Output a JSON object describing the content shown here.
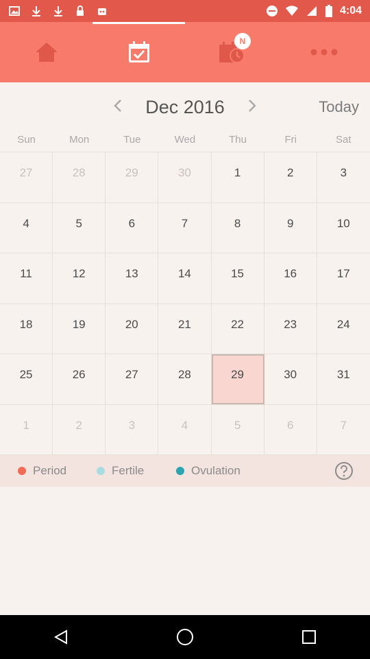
{
  "status_bar": {
    "time": "4:04",
    "left_icons": [
      "image-icon",
      "download-icon",
      "download-icon",
      "lock-icon",
      "robot-icon"
    ],
    "right_icons": [
      "do-not-disturb-icon",
      "wifi-icon",
      "signal-icon",
      "battery-icon"
    ]
  },
  "tabs": [
    {
      "name": "home",
      "icon": "home-icon"
    },
    {
      "name": "calendar",
      "icon": "calendar-check-icon",
      "active": true
    },
    {
      "name": "reminders",
      "icon": "calendar-clock-icon",
      "badge": "N"
    },
    {
      "name": "more",
      "icon": "more-dots-icon"
    }
  ],
  "calendar": {
    "month_title": "Dec 2016",
    "today_label": "Today",
    "weekdays": [
      "Sun",
      "Mon",
      "Tue",
      "Wed",
      "Thu",
      "Fri",
      "Sat"
    ],
    "weeks": [
      [
        "27",
        "28",
        "29",
        "30",
        "1",
        "2",
        "3"
      ],
      [
        "4",
        "5",
        "6",
        "7",
        "8",
        "9",
        "10"
      ],
      [
        "11",
        "12",
        "13",
        "14",
        "15",
        "16",
        "17"
      ],
      [
        "18",
        "19",
        "20",
        "21",
        "22",
        "23",
        "24"
      ],
      [
        "25",
        "26",
        "27",
        "28",
        "29",
        "30",
        "31"
      ],
      [
        "1",
        "2",
        "3",
        "4",
        "5",
        "6",
        "7"
      ]
    ],
    "selected_day": "29"
  },
  "legend": {
    "items": [
      {
        "label": "Period",
        "color": "#f46b58"
      },
      {
        "label": "Fertile",
        "color": "#a9dde3"
      },
      {
        "label": "Ovulation",
        "color": "#2aa6b3"
      }
    ]
  },
  "colors": {
    "accent": "#f77a6a",
    "status_bar": "#e2584b",
    "selected_fill": "#f9d6d0",
    "background": "#f8f2ee"
  }
}
